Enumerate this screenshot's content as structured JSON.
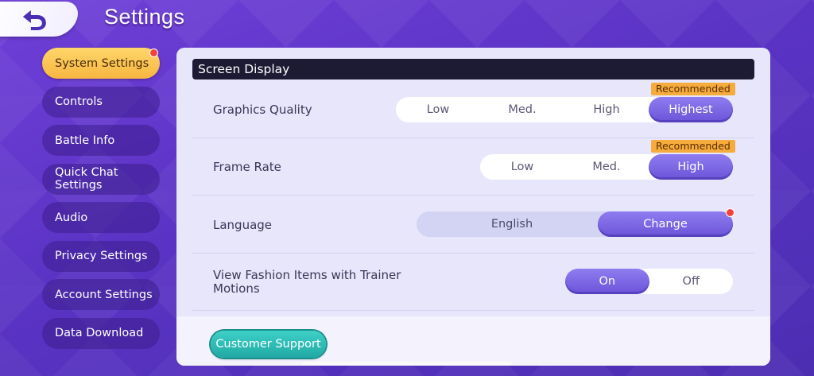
{
  "header": {
    "title": "Settings",
    "back_icon": "back-arrow-icon"
  },
  "sidebar": {
    "items": [
      {
        "label": "System Settings",
        "active": true,
        "notify": true
      },
      {
        "label": "Controls"
      },
      {
        "label": "Battle Info"
      },
      {
        "label": "Quick Chat Settings"
      },
      {
        "label": "Audio"
      },
      {
        "label": "Privacy Settings"
      },
      {
        "label": "Account Settings"
      },
      {
        "label": "Data Download"
      }
    ]
  },
  "panel": {
    "section_title": "Screen Display",
    "graphics": {
      "label": "Graphics Quality",
      "badge": "Recommended",
      "options": [
        "Low",
        "Med.",
        "High",
        "Highest"
      ],
      "selected": "Highest"
    },
    "frame_rate": {
      "label": "Frame Rate",
      "badge": "Recommended",
      "options": [
        "Low",
        "Med.",
        "High"
      ],
      "selected": "High"
    },
    "language": {
      "label": "Language",
      "value": "English",
      "change_label": "Change",
      "notify": true
    },
    "fashion": {
      "label": "View Fashion Items with Trainer Motions",
      "options": [
        "On",
        "Off"
      ],
      "selected": "On"
    },
    "support_label": "Customer Support"
  },
  "colors": {
    "accent_purple": "#6b54d8",
    "active_tab": "#f7b640",
    "recommended": "#f6ac3c",
    "support_teal": "#21a9a4",
    "notify_red": "#f2433b"
  }
}
